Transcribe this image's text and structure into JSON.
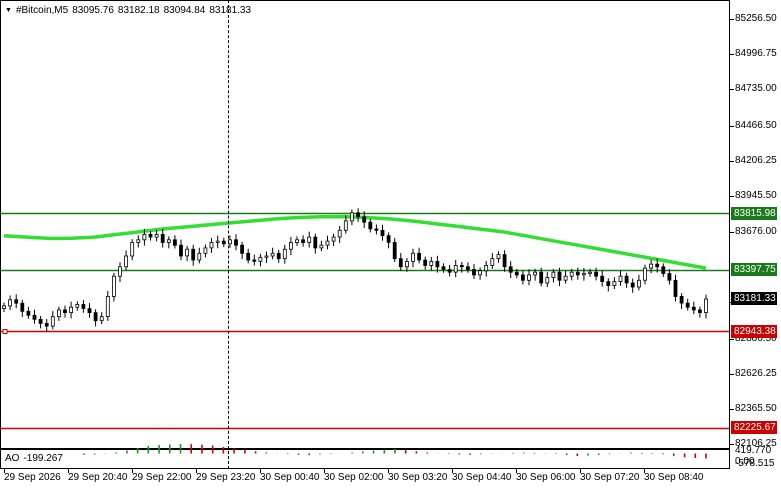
{
  "header": {
    "symbol": "#Bitcoin,M5",
    "open": "83095.76",
    "high": "83182.18",
    "low": "83094.84",
    "close": "83181.33"
  },
  "indicator": {
    "name": "AO",
    "value": "-199.267",
    "axis_labels": [
      "419.770",
      "0.00",
      "-578.515"
    ]
  },
  "price_axis": {
    "labels": [
      "85256.50",
      "84996.75",
      "84735.00",
      "84466.50",
      "84206.25",
      "83945.50",
      "83676.00",
      "83156.25",
      "82886.50",
      "82626.25",
      "82365.50",
      "82106.25"
    ]
  },
  "levels": [
    {
      "label": "83815.98",
      "price": 83815.98,
      "color": "#1a7a1a"
    },
    {
      "label": "83397.75",
      "price": 83397.75,
      "color": "#1a7a1a"
    },
    {
      "label": "82943.38",
      "price": 82943.38,
      "color": "#cc0000"
    },
    {
      "label": "82225.67",
      "price": 82225.67,
      "color": "#cc0000"
    }
  ],
  "current_price": {
    "label": "83181.33",
    "price": 83181.33
  },
  "time_axis": {
    "labels": [
      "29 Sep 2026",
      "29 Sep 20:40",
      "29 Sep 22:00",
      "29 Sep 23:20",
      "30 Sep 00:40",
      "30 Sep 02:00",
      "30 Sep 03:20",
      "30 Sep 04:40",
      "30 Sep 06:00",
      "30 Sep 07:20",
      "30 Sep 08:40"
    ]
  },
  "colors": {
    "support_line": "#cc0000",
    "resistance_line": "#1a7a1a",
    "moving_average": "#33dd33",
    "candles": "#000000",
    "ao_up": "#1a9a1a",
    "ao_down": "#cc0000"
  },
  "chart_data": {
    "type": "candlestick",
    "timeframe": "M5",
    "ylim": [
      82106.25,
      85256.5
    ],
    "x_range": [
      "29 Sep 2026 19:20",
      "30 Sep 2026 09:55"
    ],
    "closes": [
      83130,
      83175,
      83150,
      83090,
      83060,
      83030,
      83000,
      82980,
      83050,
      83100,
      83080,
      83120,
      83140,
      83110,
      83080,
      83020,
      83050,
      83200,
      83350,
      83420,
      83500,
      83600,
      83620,
      83660,
      83640,
      83660,
      83600,
      83620,
      83580,
      83500,
      83550,
      83470,
      83520,
      83560,
      83600,
      83610,
      83590,
      83620,
      83580,
      83520,
      83470,
      83460,
      83490,
      83500,
      83520,
      83480,
      83550,
      83600,
      83620,
      83600,
      83640,
      83560,
      83580,
      83610,
      83640,
      83690,
      83760,
      83820,
      83790,
      83750,
      83700,
      83690,
      83650,
      83600,
      83480,
      83420,
      83460,
      83520,
      83470,
      83430,
      83460,
      83420,
      83400,
      83380,
      83430,
      83420,
      83400,
      83360,
      83390,
      83430,
      83480,
      83510,
      83420,
      83380,
      83360,
      83320,
      83360,
      83380,
      83300,
      83340,
      83380,
      83320,
      83350,
      83380,
      83360,
      83370,
      83380,
      83350,
      83310,
      83280,
      83310,
      83350,
      83300,
      83270,
      83320,
      83410,
      83440,
      83420,
      83370,
      83320,
      83200,
      83150,
      83120,
      83100,
      83080,
      83181
    ],
    "moving_average": [
      83650,
      83640,
      83630,
      83632,
      83640,
      83660,
      83680,
      83700,
      83715,
      83730,
      83745,
      83760,
      83775,
      83785,
      83790,
      83792,
      83785,
      83775,
      83760,
      83740,
      83720,
      83700,
      83680,
      83650,
      83620,
      83590,
      83560,
      83530,
      83500,
      83470,
      83440,
      83410
    ],
    "ao_values": [
      -60,
      -40,
      -10,
      40,
      120,
      220,
      300,
      340,
      360,
      380,
      370,
      350,
      320,
      260,
      200,
      150,
      90,
      40,
      10,
      -20,
      -50,
      -60,
      -40,
      -20,
      10,
      40,
      80,
      120,
      160,
      180,
      140,
      90,
      40,
      10,
      -20,
      -40,
      -50,
      -30,
      -10,
      10,
      30,
      40,
      30,
      10,
      -20,
      -60,
      -100,
      -80,
      -60,
      -30,
      10,
      40,
      30,
      20,
      -30,
      -90,
      -150,
      -180,
      -199
    ]
  }
}
